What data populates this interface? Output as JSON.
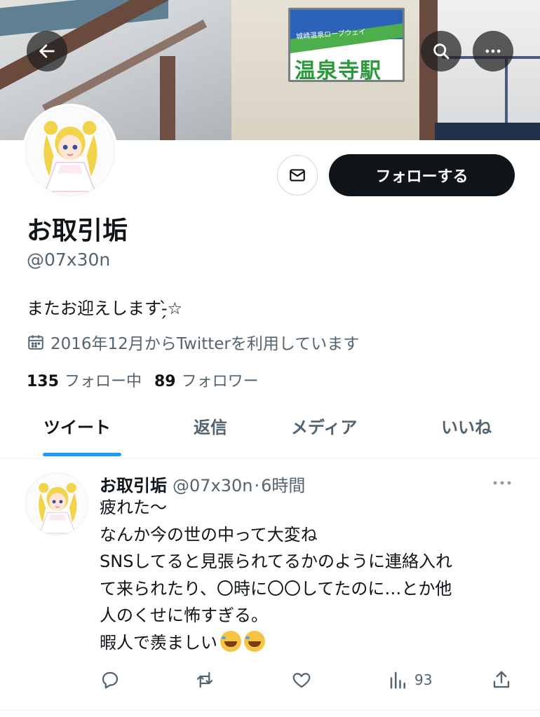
{
  "banner": {
    "sign_small": "城崎温泉ロープウェイ",
    "sign_main": "温泉寺駅"
  },
  "header_buttons": {
    "back_icon": "arrow-left-icon",
    "search_icon": "search-icon",
    "more_icon": "more-horizontal-icon"
  },
  "profile": {
    "display_name": "お取引垢",
    "handle": "@07x30n",
    "bio": "またお迎えします-̗̀☆",
    "joined": "2016年12月からTwitterを利用しています",
    "following_count": "135",
    "following_label": "フォロー中",
    "followers_count": "89",
    "followers_label": "フォロワー",
    "follow_button": "フォローする"
  },
  "tabs": [
    {
      "label": "ツイート"
    },
    {
      "label": "返信"
    },
    {
      "label": "メディア"
    },
    {
      "label": "いいね"
    }
  ],
  "tweet": {
    "name": "お取引垢",
    "handle": "@07x30n",
    "separator": "·",
    "time": "6時間",
    "lines": [
      "疲れた〜",
      "なんか今の世の中って大変ね",
      "SNSしてると見張られてるかのように連絡入れ",
      "て来られたり、〇時に〇〇してたのに…とか他",
      "人のくせに怖すぎる。",
      "暇人で羨ましい"
    ],
    "views": "93"
  },
  "colors": {
    "accent": "#1d9bf0",
    "text": "#0f1419",
    "secondary": "#536471",
    "follow_bg": "#0f1419"
  }
}
